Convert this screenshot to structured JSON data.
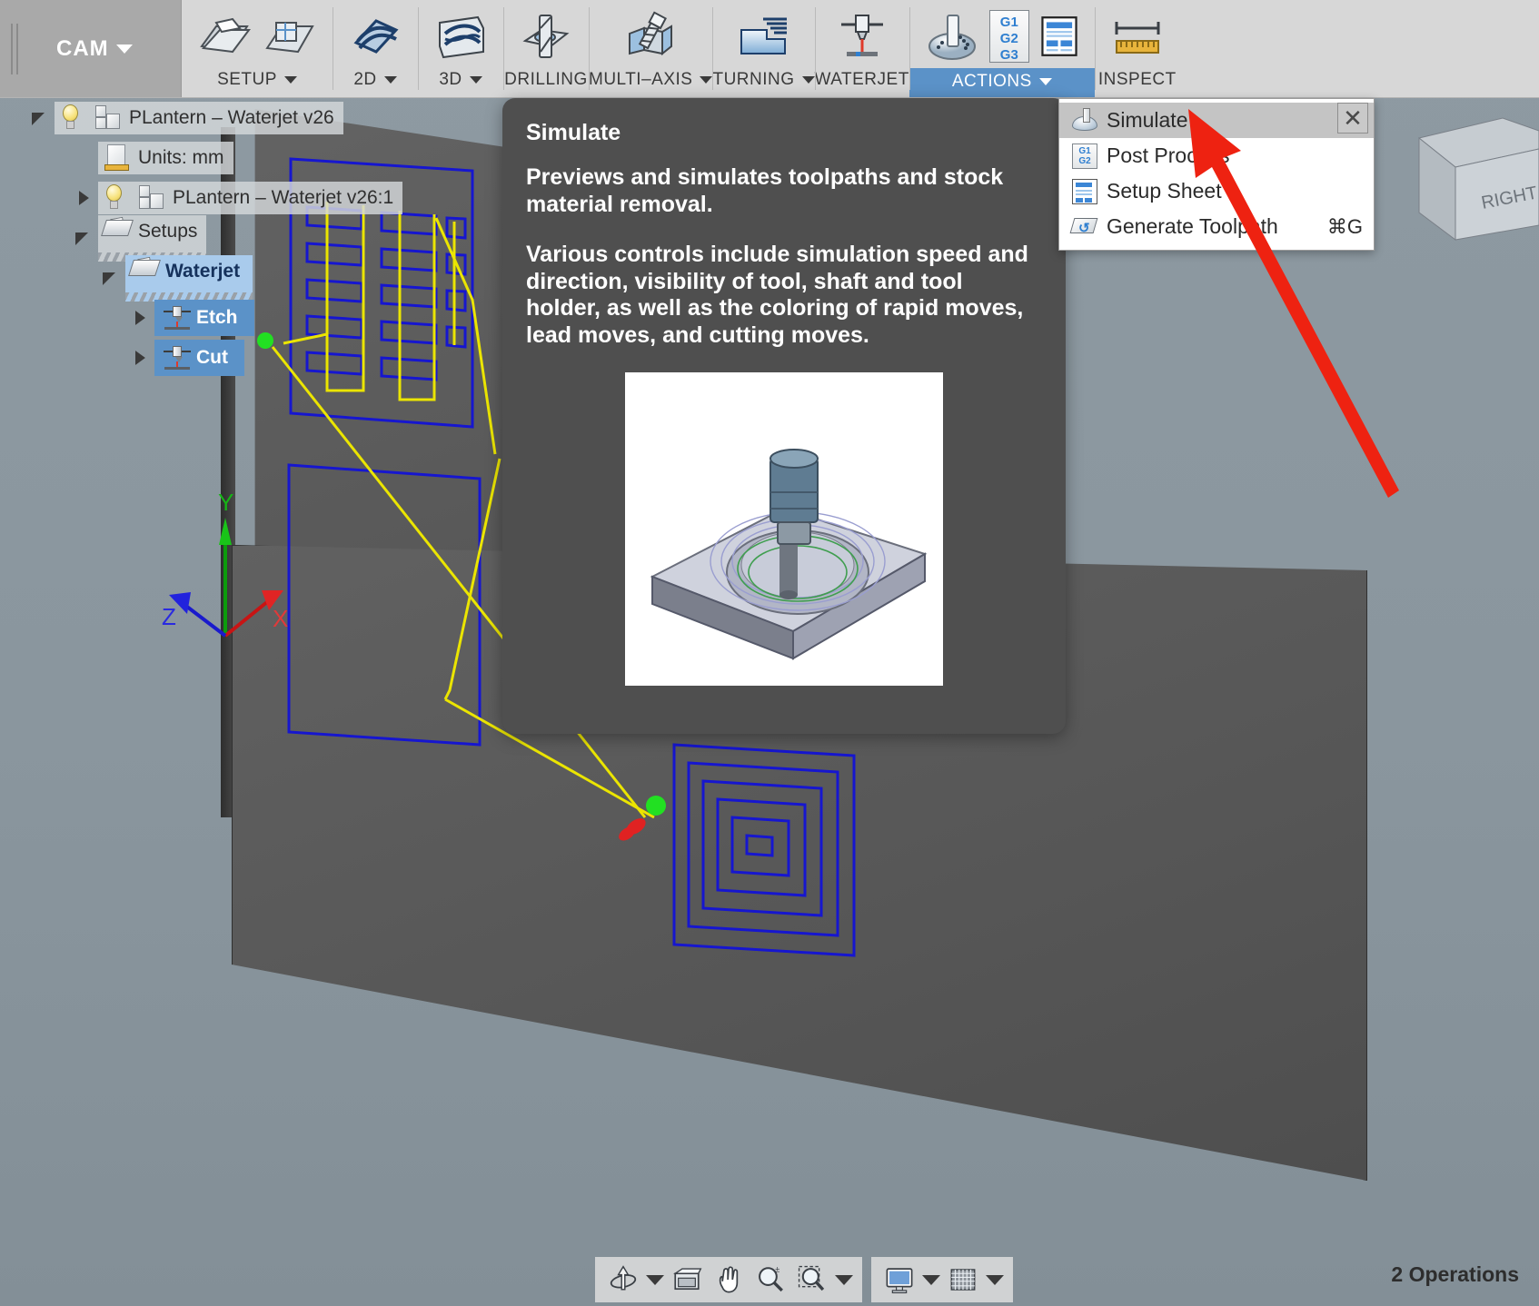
{
  "app": {
    "workspace": "CAM",
    "workspace_icon": "chevron-down-icon"
  },
  "ribbon": {
    "groups": [
      {
        "label": "SETUP",
        "has_dropdown": true,
        "icons": [
          "new-setup-icon",
          "new-folder-icon"
        ]
      },
      {
        "label": "2D",
        "has_dropdown": true,
        "icons": [
          "2d-milling-icon"
        ]
      },
      {
        "label": "3D",
        "has_dropdown": true,
        "icons": [
          "3d-milling-icon"
        ]
      },
      {
        "label": "DRILLING",
        "has_dropdown": false,
        "icons": [
          "drilling-icon"
        ]
      },
      {
        "label": "MULTI–AXIS",
        "has_dropdown": true,
        "icons": [
          "multi-axis-icon"
        ]
      },
      {
        "label": "TURNING",
        "has_dropdown": true,
        "icons": [
          "turning-icon"
        ]
      },
      {
        "label": "WATERJET",
        "has_dropdown": false,
        "icons": [
          "waterjet-icon"
        ]
      },
      {
        "label": "ACTIONS",
        "has_dropdown": true,
        "active": true,
        "icons": [
          "simulate-icon",
          "post-process-icon",
          "setup-sheet-icon"
        ]
      },
      {
        "label": "INSPECT",
        "has_dropdown": false,
        "icons": [
          "measure-icon"
        ]
      }
    ]
  },
  "browser": {
    "rows": [
      {
        "indent": 0,
        "twisty": "open",
        "icons": [
          "light-bulb-icon",
          "part-icon"
        ],
        "label": "PLantern – Waterjet v26",
        "selected": "none"
      },
      {
        "indent": 1,
        "twisty": "none",
        "icons": [
          "units-doc-icon"
        ],
        "label": "Units: mm",
        "selected": "none"
      },
      {
        "indent": 1,
        "twisty": "closed",
        "icons": [
          "light-bulb-icon",
          "part-icon"
        ],
        "label": "PLantern – Waterjet v26:1",
        "selected": "none"
      },
      {
        "indent": 1,
        "twisty": "open",
        "icons": [
          "setups-folder-icon"
        ],
        "label": "Setups",
        "selected": "none"
      },
      {
        "indent": 2,
        "twisty": "open",
        "icons": [
          "setup-icon"
        ],
        "label": "Waterjet",
        "selected": "light"
      },
      {
        "indent": 3,
        "twisty": "closed",
        "icons": [
          "waterjet-op-icon"
        ],
        "label": "Etch",
        "selected": "dark"
      },
      {
        "indent": 3,
        "twisty": "closed",
        "icons": [
          "waterjet-op-icon"
        ],
        "label": "Cut",
        "selected": "dark"
      }
    ]
  },
  "tooltip": {
    "title": "Simulate",
    "paragraph1": "Previews and simulates toolpaths and stock material removal.",
    "paragraph2": "Various controls include simulation speed and direction, visibility of tool, shaft and tool holder, as well as the coloring of rapid moves, lead moves, and cutting moves.",
    "image_alt": "simulation-preview-image"
  },
  "actions_menu": {
    "items": [
      {
        "label": "Simulate",
        "icon": "simulate-icon",
        "shortcut": "",
        "highlighted": true
      },
      {
        "label": "Post Process",
        "icon": "post-process-icon",
        "shortcut": "",
        "highlighted": false
      },
      {
        "label": "Setup Sheet",
        "icon": "setup-sheet-icon",
        "shortcut": "",
        "highlighted": false
      },
      {
        "label": "Generate Toolpath",
        "icon": "generate-toolpath-icon",
        "shortcut": "⌘G",
        "highlighted": false
      }
    ],
    "close_label": "✕"
  },
  "viewcube": {
    "face_label": "RIGHT"
  },
  "viewport": {
    "axis_labels": {
      "x": "X",
      "y": "Y",
      "z": "Z"
    }
  },
  "navbar": {
    "group1": [
      {
        "name": "orbit-icon",
        "dropdown": true
      },
      {
        "name": "pan-view-icon",
        "dropdown": false
      },
      {
        "name": "pan-hand-icon",
        "dropdown": false
      },
      {
        "name": "zoom-icon",
        "dropdown": false
      },
      {
        "name": "zoom-window-icon",
        "dropdown": true
      }
    ],
    "group2": [
      {
        "name": "display-settings-icon",
        "dropdown": true
      },
      {
        "name": "grid-snap-icon",
        "dropdown": true
      }
    ]
  },
  "status": {
    "operations_text": "2 Operations"
  },
  "colors": {
    "accent_blue": "#5b92c8",
    "ribbon_bg": "#d7d7d7",
    "workspace_bg": "#a9a9a9",
    "viewport_bg": "#8c99a1",
    "tooltip_bg": "#4f4f4f",
    "toolpath_cut": "#1818c8",
    "toolpath_lead": "#e8e800",
    "arrow_red": "#ee2211",
    "selection_light": "#a9cbec",
    "selection_dark": "#5b92c8"
  }
}
